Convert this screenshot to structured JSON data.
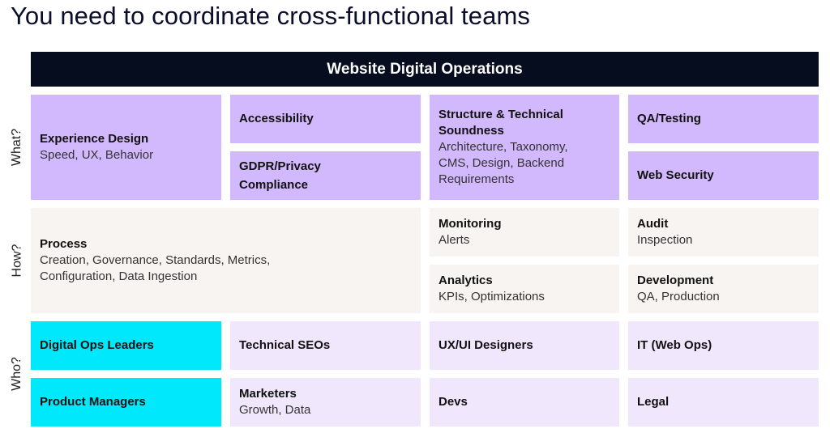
{
  "page": {
    "title": "You need to coordinate cross-functional teams"
  },
  "header": {
    "title": "Website Digital Operations",
    "color": "#060d1f"
  },
  "colors": {
    "what": "#d2b8fc",
    "how": "#f7f4f1",
    "who_leads": "#00e8fb",
    "who": "#f0e7fd"
  },
  "rows": {
    "what": {
      "label": "What?",
      "cells": [
        {
          "title": "Experience Design",
          "subtitle": "Speed, UX, Behavior"
        },
        {
          "title": "Accessibility"
        },
        {
          "title": "GDPR/Privacy Compliance"
        },
        {
          "title": "Structure & Technical Soundness",
          "subtitle": "Architecture, Taxonomy, CMS, Design, Backend Requirements"
        },
        {
          "title": "QA/Testing"
        },
        {
          "title": "Web Security"
        }
      ]
    },
    "how": {
      "label": "How?",
      "cells": [
        {
          "title": "Process",
          "subtitle": "Creation, Governance, Standards, Metrics, Configuration, Data Ingestion"
        },
        {
          "title": "Monitoring",
          "subtitle": "Alerts"
        },
        {
          "title": "Audit",
          "subtitle": "Inspection"
        },
        {
          "title": "Analytics",
          "subtitle": "KPIs, Optimizations"
        },
        {
          "title": "Development",
          "subtitle": "QA, Production"
        }
      ]
    },
    "who": {
      "label": "Who?",
      "cells": [
        {
          "title": "Digital Ops Leaders"
        },
        {
          "title": "Technical SEOs"
        },
        {
          "title": "UX/UI Designers"
        },
        {
          "title": "IT (Web Ops)"
        },
        {
          "title": "Product Managers"
        },
        {
          "title": "Marketers",
          "subtitle": "Growth, Data"
        },
        {
          "title": "Devs"
        },
        {
          "title": "Legal"
        }
      ]
    }
  }
}
